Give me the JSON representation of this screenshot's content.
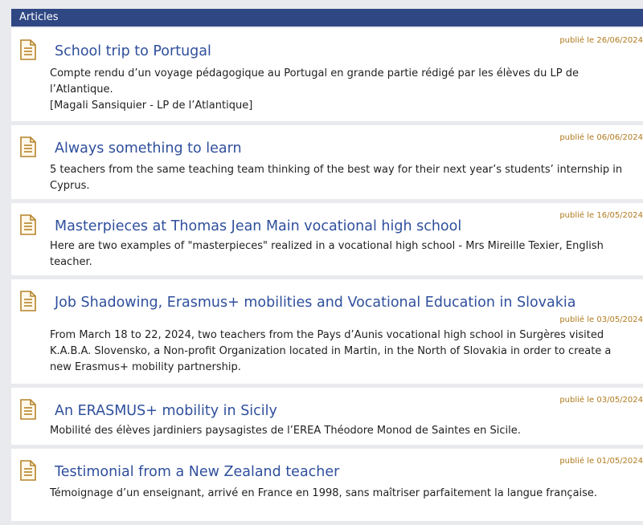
{
  "section": {
    "title": "Articles"
  },
  "accent": "#2f4783",
  "link_color": "#2f4f9c",
  "date_color": "#b07a1e",
  "icon": "document-icon",
  "articles": [
    {
      "title": "School trip to Portugal",
      "date": "publié le 26/06/2024",
      "body": "Compte rendu d’un voyage pédagogique au Portugal en grande partie rédigé par les élèves du LP de l’Atlantique.",
      "author": "[Magali Sansiquier - LP de l’Atlantique]"
    },
    {
      "title": "Always something to learn",
      "date": "publié le 06/06/2024",
      "body": "5 teachers from the same teaching team thinking of the best way for their next year’s students’ internship in Cyprus."
    },
    {
      "title": "Masterpieces at Thomas Jean Main vocational high school",
      "date": "publié le 16/05/2024",
      "body": "Here are two examples of \"masterpieces\" realized in a vocational high school - Mrs Mireille Texier, English teacher."
    },
    {
      "title": "Job Shadowing, Erasmus+ mobilities and Vocational Education in Slovakia",
      "date": "publié le 03/05/2024",
      "body": "From March 18 to 22, 2024, two teachers from the Pays d’Aunis vocational high school in Surgères visited K.A.B.A. Slovensko, a Non-profit Organization located in Martin, in the North of Slovakia in order to create a new Erasmus+ mobility partnership."
    },
    {
      "title": "An ERASMUS+ mobility in Sicily",
      "date": "publié le 03/05/2024",
      "body": "Mobilité des élèves jardiniers paysagistes de l’EREA Théodore Monod de Saintes en Sicile."
    },
    {
      "title": "Testimonial from a New Zealand teacher",
      "date": "publié le 01/05/2024",
      "body": "Témoignage d’un enseignant, arrivé en France en 1998, sans maîtriser parfaitement la langue française."
    }
  ]
}
